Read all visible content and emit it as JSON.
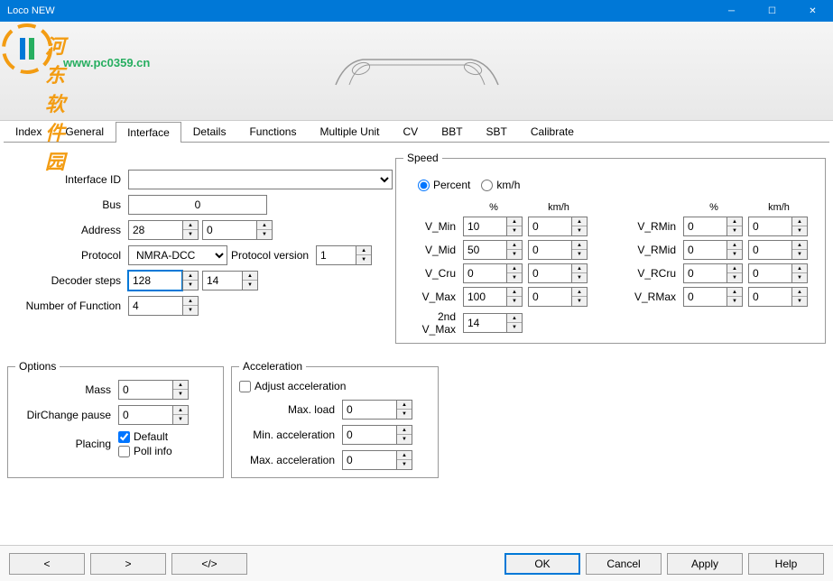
{
  "window": {
    "title": "Loco NEW"
  },
  "watermark": {
    "text1": "河东软件园",
    "text2": "www.pc0359.cn"
  },
  "tabs": {
    "items": [
      "Index",
      "General",
      "Interface",
      "Details",
      "Functions",
      "Multiple Unit",
      "CV",
      "BBT",
      "SBT",
      "Calibrate"
    ],
    "active": 2
  },
  "interface": {
    "interface_id_label": "Interface ID",
    "interface_id": "",
    "bus_label": "Bus",
    "bus": "0",
    "address_label": "Address",
    "address1": "28",
    "address2": "0",
    "protocol_label": "Protocol",
    "protocol": "NMRA-DCC",
    "protocol_version_label": "Protocol version",
    "protocol_version": "1",
    "decoder_steps_label": "Decoder steps",
    "decoder_steps1": "128",
    "decoder_steps2": "14",
    "num_func_label": "Number of Function",
    "num_func": "4"
  },
  "speed": {
    "legend": "Speed",
    "unit_percent": "Percent",
    "unit_kmh": "km/h",
    "hdr_pct": "%",
    "hdr_kmh": "km/h",
    "vmin_label": "V_Min",
    "vmin_pct": "10",
    "vmin_kmh": "0",
    "vmid_label": "V_Mid",
    "vmid_pct": "50",
    "vmid_kmh": "0",
    "vcru_label": "V_Cru",
    "vcru_pct": "0",
    "vcru_kmh": "0",
    "vmax_label": "V_Max",
    "vmax_pct": "100",
    "vmax_kmh": "0",
    "v2max_label": "2nd V_Max",
    "v2max": "14",
    "vrmin_label": "V_RMin",
    "vrmin_pct": "0",
    "vrmin_kmh": "0",
    "vrmid_label": "V_RMid",
    "vrmid_pct": "0",
    "vrmid_kmh": "0",
    "vrcru_label": "V_RCru",
    "vrcru_pct": "0",
    "vrcru_kmh": "0",
    "vrmax_label": "V_RMax",
    "vrmax_pct": "0",
    "vrmax_kmh": "0"
  },
  "options": {
    "legend": "Options",
    "mass_label": "Mass",
    "mass": "0",
    "dirchange_label": "DirChange pause",
    "dirchange": "0",
    "placing_label": "Placing",
    "default_label": "Default",
    "pollinfo_label": "Poll info"
  },
  "accel": {
    "legend": "Acceleration",
    "adjust_label": "Adjust acceleration",
    "maxload_label": "Max. load",
    "maxload": "0",
    "minaccel_label": "Min. acceleration",
    "minaccel": "0",
    "maxaccel_label": "Max. acceleration",
    "maxaccel": "0"
  },
  "footer": {
    "prev": "<",
    "next": ">",
    "both": "</>",
    "ok": "OK",
    "cancel": "Cancel",
    "apply": "Apply",
    "help": "Help"
  }
}
